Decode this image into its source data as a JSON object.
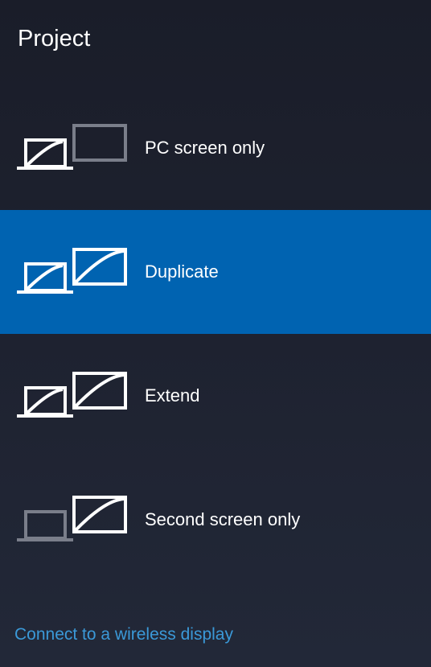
{
  "title": "Project",
  "options": [
    {
      "label": "PC screen only"
    },
    {
      "label": "Duplicate"
    },
    {
      "label": "Extend"
    },
    {
      "label": "Second screen only"
    }
  ],
  "selected_index": 1,
  "footer_link": "Connect to a wireless display"
}
